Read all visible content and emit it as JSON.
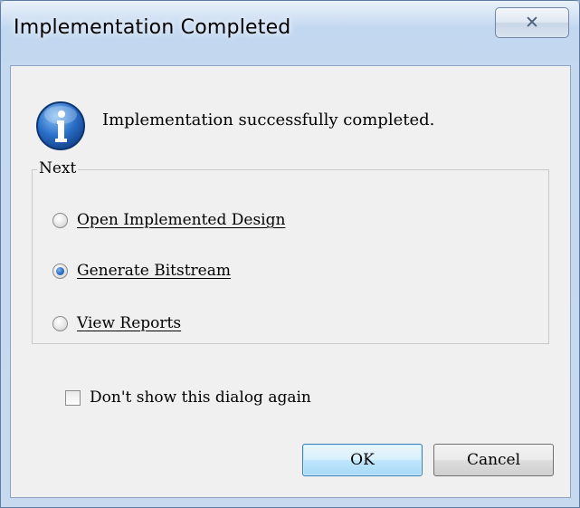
{
  "window": {
    "title": "Implementation Completed",
    "close_glyph": "✕"
  },
  "message": {
    "icon": "info-icon",
    "text": "Implementation successfully completed."
  },
  "next_group": {
    "label": "Next",
    "options": [
      {
        "label": "Open Implemented Design",
        "checked": false
      },
      {
        "label": "Generate Bitstream",
        "checked": true
      },
      {
        "label": "View Reports",
        "checked": false
      }
    ]
  },
  "dont_show": {
    "label": "Don't show this dialog again",
    "checked": false
  },
  "buttons": {
    "ok": "OK",
    "cancel": "Cancel"
  },
  "colors": {
    "title_bar": "#bcd3ee",
    "client_bg": "#f0f0f0",
    "ok_button": "#bee6fd",
    "info_icon": "#2a6fc9"
  }
}
